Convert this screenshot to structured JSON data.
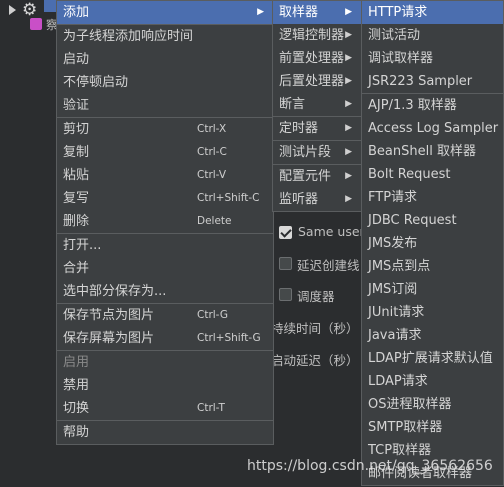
{
  "tree": {
    "row2_text": "察"
  },
  "background": {
    "same_user": "Same user",
    "delay_create": "延迟创建线",
    "scheduler": "调度器",
    "duration": "持续时间（秒）",
    "startup_delay": "启动延迟（秒）"
  },
  "context_menu": [
    {
      "label": "添加",
      "submenu": true,
      "selected": true
    },
    {
      "sep": true
    },
    {
      "label": "为子线程添加响应时间"
    },
    {
      "label": "启动"
    },
    {
      "label": "不停顿启动"
    },
    {
      "label": "验证"
    },
    {
      "sep": true
    },
    {
      "label": "剪切",
      "shortcut": "Ctrl-X"
    },
    {
      "label": "复制",
      "shortcut": "Ctrl-C"
    },
    {
      "label": "粘贴",
      "shortcut": "Ctrl-V"
    },
    {
      "label": "复写",
      "shortcut": "Ctrl+Shift-C"
    },
    {
      "label": "删除",
      "shortcut": "Delete"
    },
    {
      "sep": true
    },
    {
      "label": "打开..."
    },
    {
      "label": "合并"
    },
    {
      "label": "选中部分保存为..."
    },
    {
      "sep": true
    },
    {
      "label": "保存节点为图片",
      "shortcut": "Ctrl-G"
    },
    {
      "label": "保存屏幕为图片",
      "shortcut": "Ctrl+Shift-G"
    },
    {
      "sep": true
    },
    {
      "label": "启用",
      "disabled": true
    },
    {
      "label": "禁用"
    },
    {
      "label": "切换",
      "shortcut": "Ctrl-T"
    },
    {
      "sep": true
    },
    {
      "label": "帮助"
    }
  ],
  "add_submenu": [
    {
      "label": "取样器",
      "submenu": true,
      "selected": true
    },
    {
      "label": "逻辑控制器",
      "submenu": true
    },
    {
      "label": "前置处理器",
      "submenu": true
    },
    {
      "label": "后置处理器",
      "submenu": true
    },
    {
      "label": "断言",
      "submenu": true
    },
    {
      "sep": true
    },
    {
      "label": "定时器",
      "submenu": true
    },
    {
      "sep": true
    },
    {
      "label": "测试片段",
      "submenu": true
    },
    {
      "sep": true
    },
    {
      "label": "配置元件",
      "submenu": true
    },
    {
      "label": "监听器",
      "submenu": true
    }
  ],
  "sampler_submenu": [
    {
      "label": "HTTP请求",
      "selected": true
    },
    {
      "label": "测试活动"
    },
    {
      "label": "调试取样器"
    },
    {
      "label": "JSR223 Sampler"
    },
    {
      "sep": true
    },
    {
      "label": "AJP/1.3 取样器"
    },
    {
      "label": "Access Log Sampler"
    },
    {
      "label": "BeanShell 取样器"
    },
    {
      "label": "Bolt Request"
    },
    {
      "label": "FTP请求"
    },
    {
      "label": "JDBC Request"
    },
    {
      "label": "JMS发布"
    },
    {
      "label": "JMS点到点"
    },
    {
      "label": "JMS订阅"
    },
    {
      "label": "JUnit请求"
    },
    {
      "label": "Java请求"
    },
    {
      "label": "LDAP扩展请求默认值"
    },
    {
      "label": "LDAP请求"
    },
    {
      "label": "OS进程取样器"
    },
    {
      "label": "SMTP取样器"
    },
    {
      "label": "TCP取样器"
    },
    {
      "label": "邮件阅读者取样器"
    }
  ],
  "watermark": "https://blog.csdn.net/qq_36562656",
  "colors": {
    "menu_bg": "#3c3f41",
    "selected_bg": "#4b6eaf",
    "window_bg": "#2b2d2f"
  }
}
